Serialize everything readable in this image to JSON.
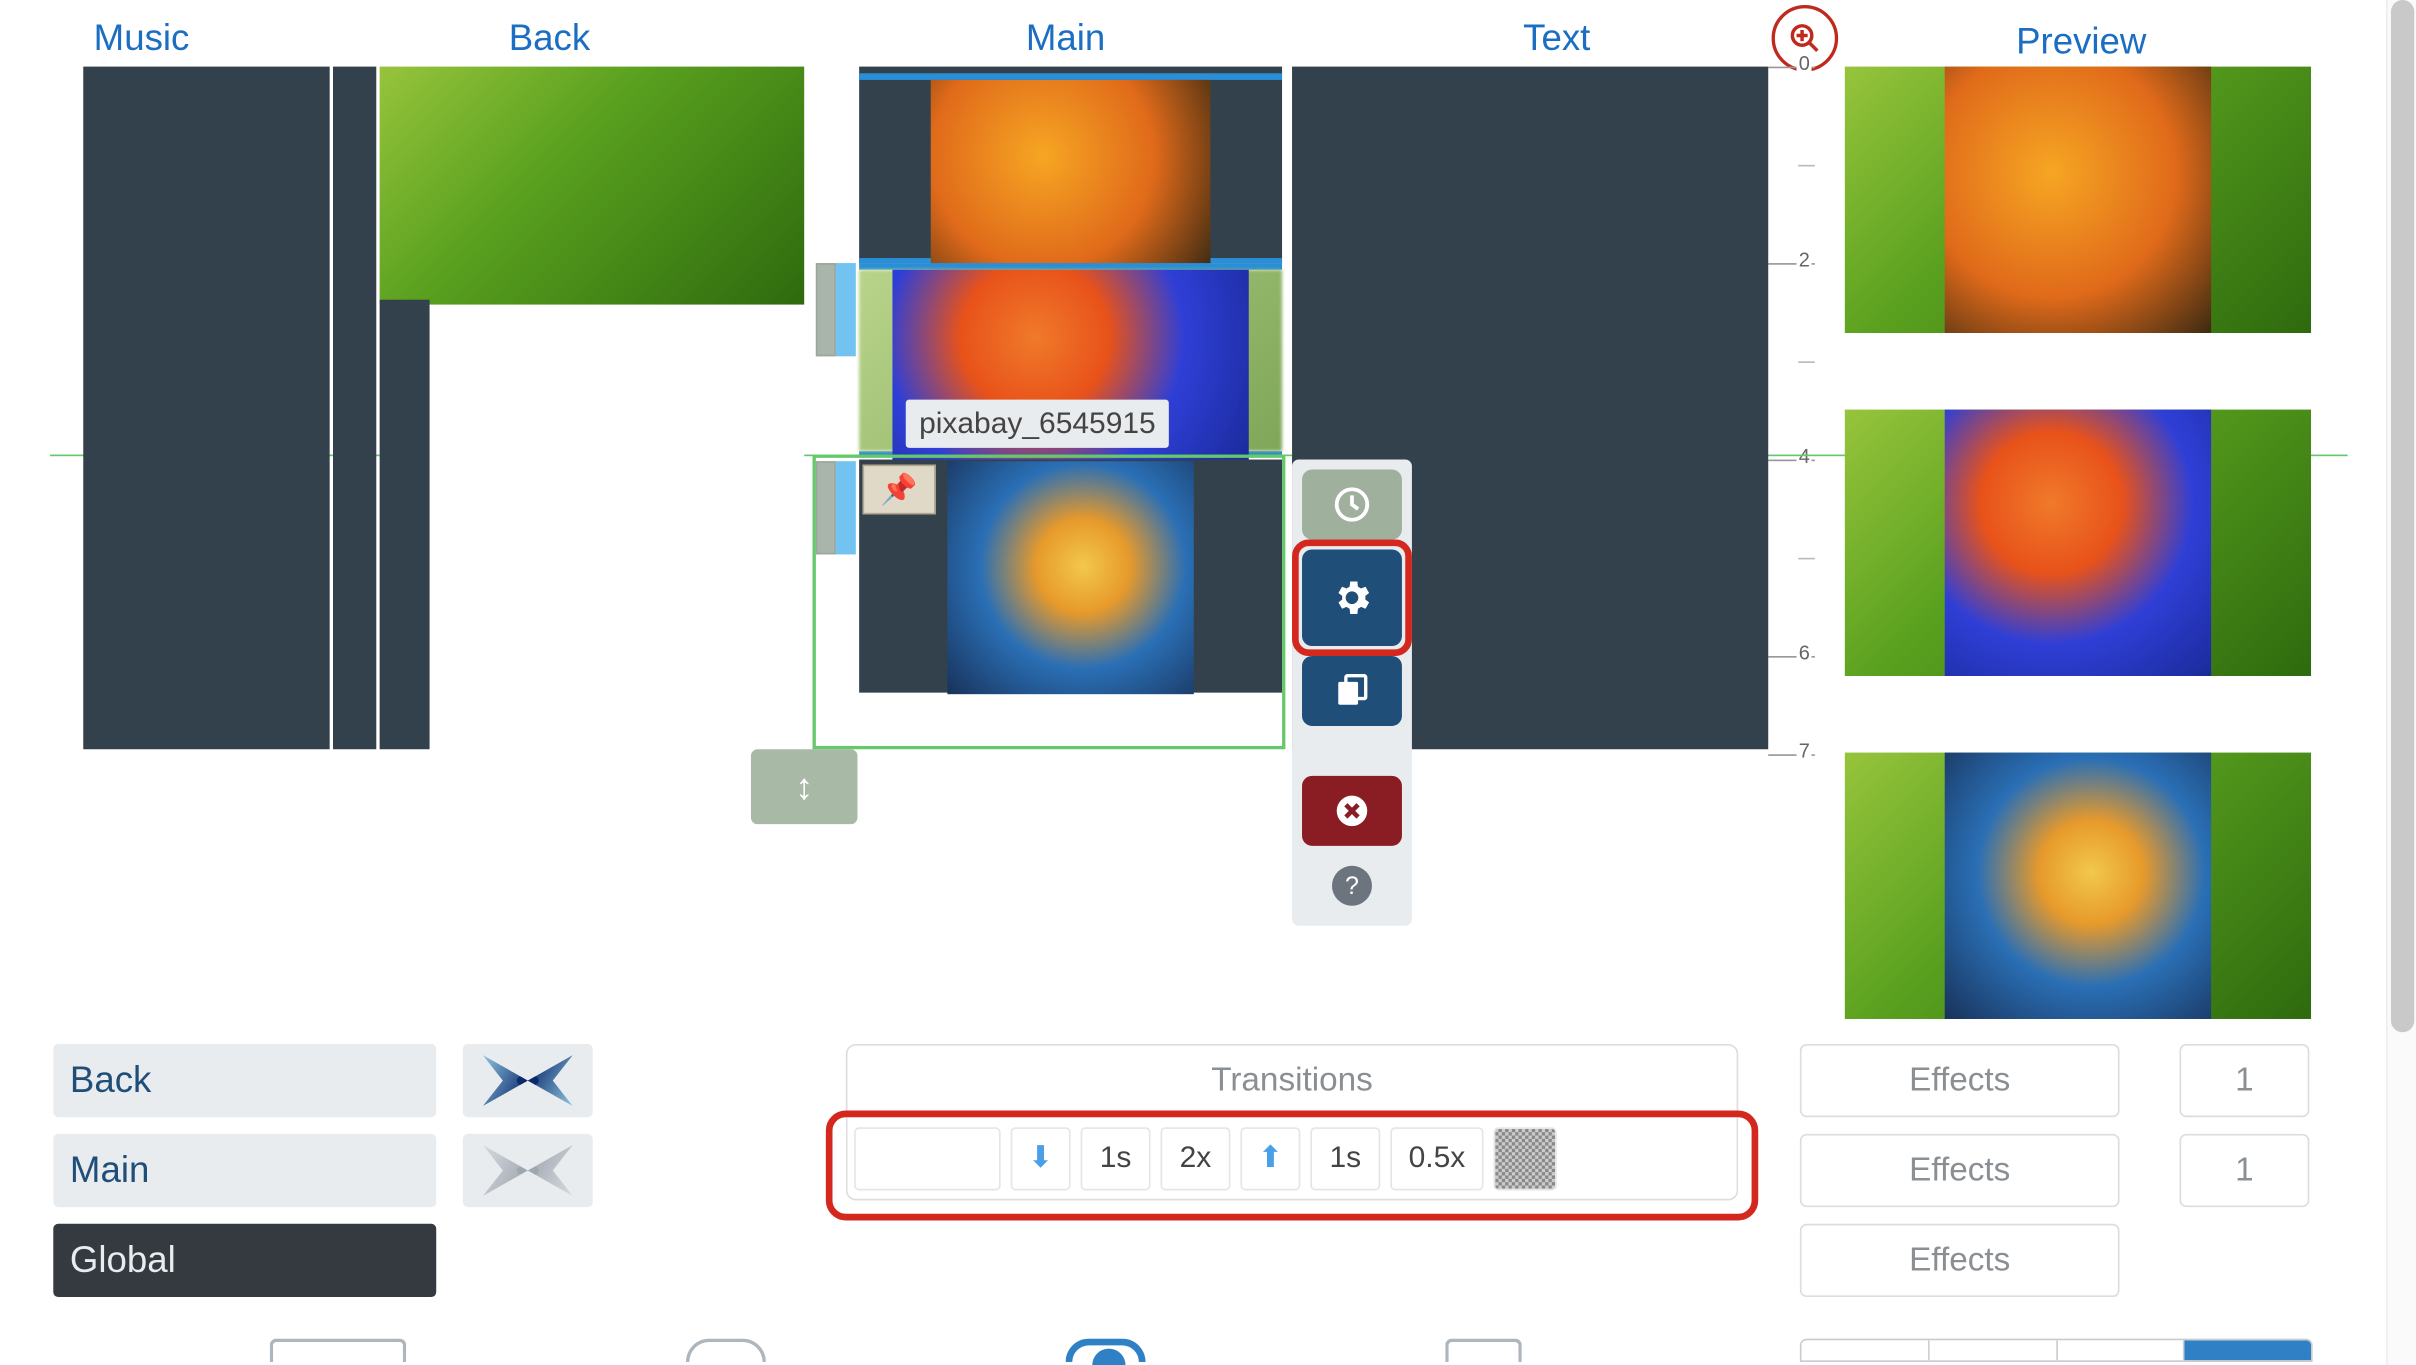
{
  "columns": {
    "music": "Music",
    "back": "Back",
    "main": "Main",
    "text": "Text",
    "preview": "Preview"
  },
  "ruler_labels": [
    "0",
    "2",
    "4",
    "6",
    "7"
  ],
  "clip_tooltip": "pixabay_6545915",
  "action_menu": {
    "clock": "clock-icon",
    "gear": "gear-icon",
    "copy": "copy-icon",
    "delete": "delete-icon",
    "help": "?"
  },
  "layers": {
    "back": "Back",
    "main": "Main",
    "global": "Global"
  },
  "transitions": {
    "header": "Transitions",
    "cells": {
      "in_dur": "1s",
      "in_speed": "2x",
      "out_dur": "1s",
      "out_speed": "0.5x"
    }
  },
  "effects": {
    "label": "Effects",
    "count1": "1",
    "count2": "1"
  }
}
